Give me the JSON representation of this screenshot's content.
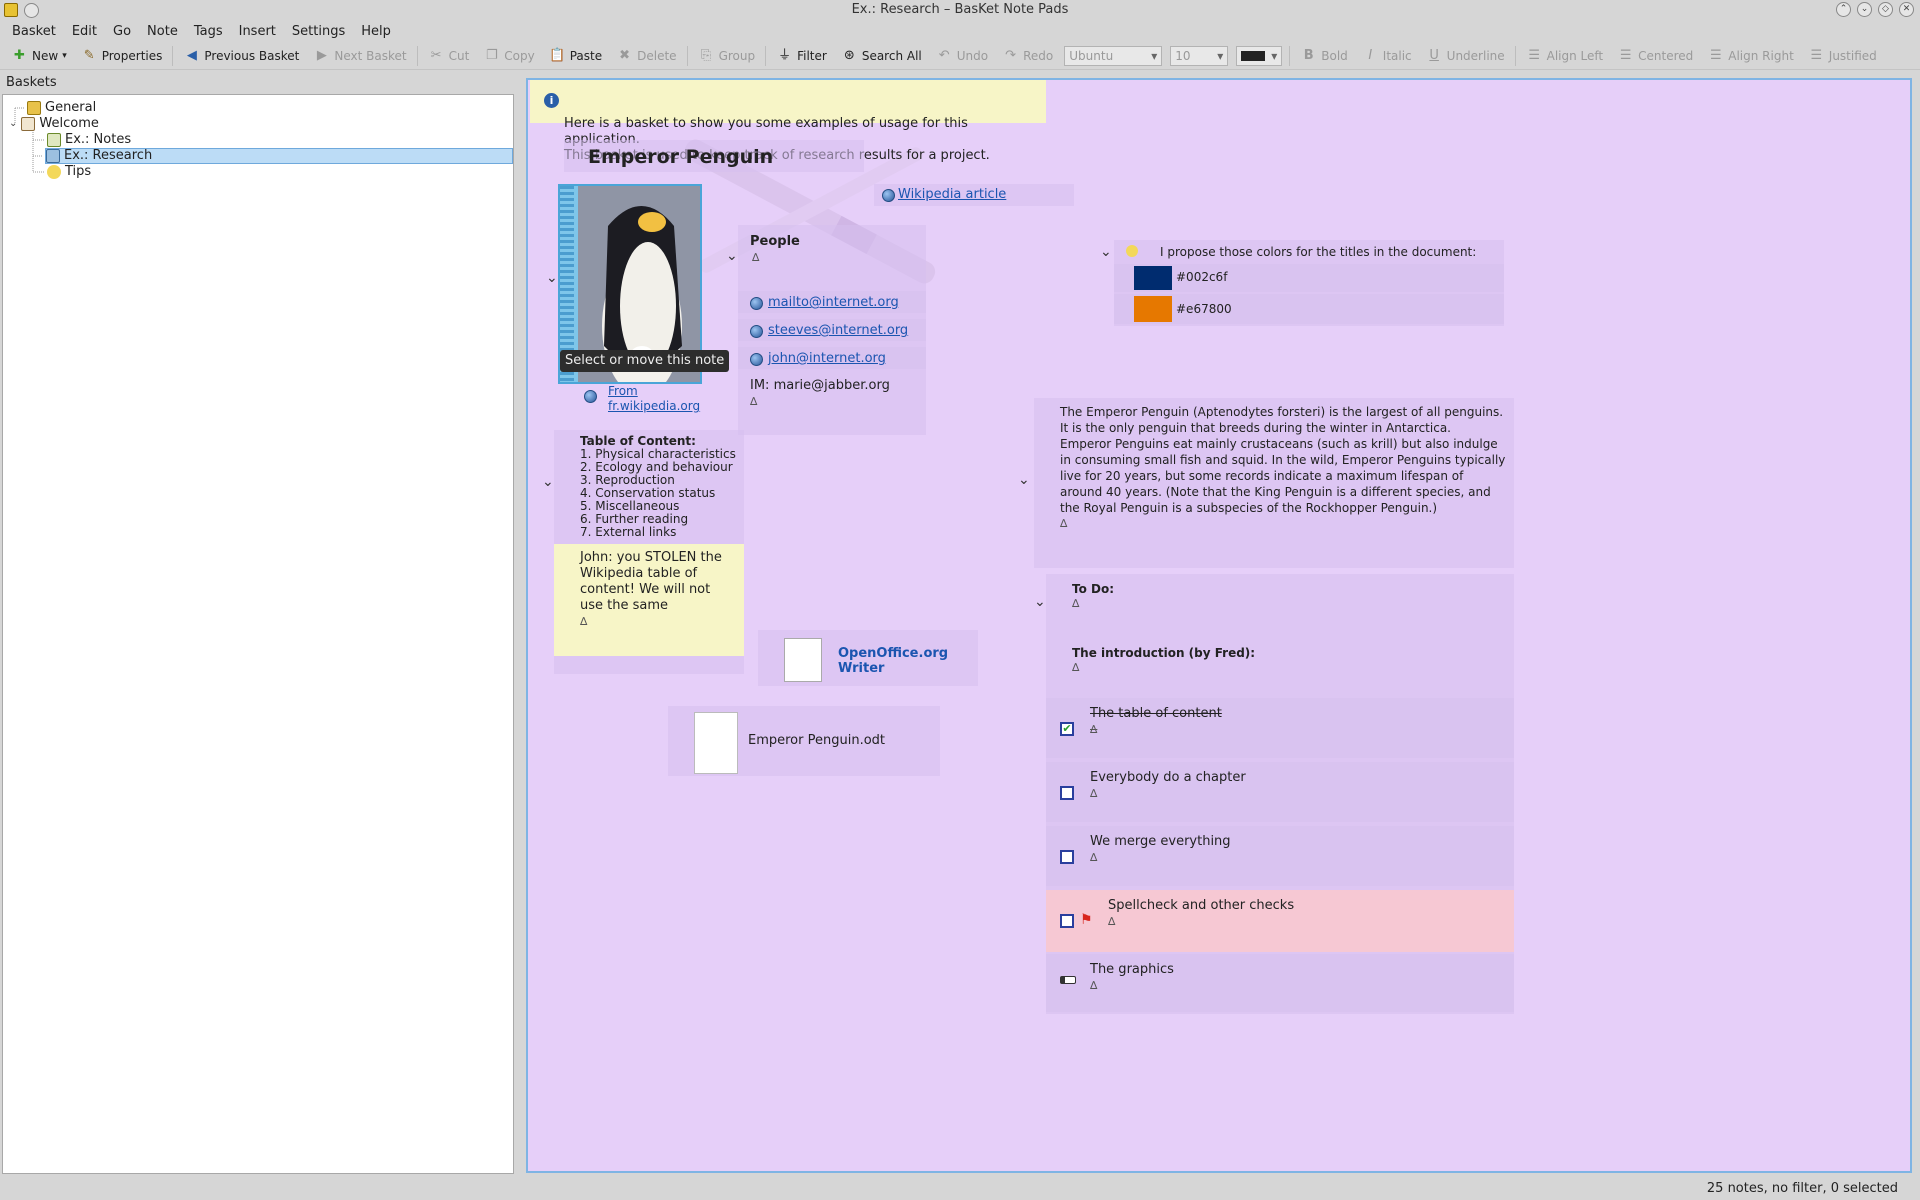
{
  "window": {
    "title": "Ex.: Research – BasKet Note Pads"
  },
  "menu": [
    "Basket",
    "Edit",
    "Go",
    "Note",
    "Tags",
    "Insert",
    "Settings",
    "Help"
  ],
  "toolbar": {
    "new": "New",
    "properties": "Properties",
    "previous_basket": "Previous Basket",
    "next_basket": "Next Basket",
    "cut": "Cut",
    "copy": "Copy",
    "paste": "Paste",
    "delete": "Delete",
    "group": "Group",
    "filter": "Filter",
    "search_all": "Search All",
    "undo": "Undo",
    "redo": "Redo",
    "font": "Ubuntu",
    "font_size": "10",
    "bold": "Bold",
    "italic": "Italic",
    "underline": "Underline",
    "align_left": "Align Left",
    "centered": "Centered",
    "align_right": "Align Right",
    "justified": "Justified"
  },
  "sidebar": {
    "header": "Baskets",
    "items": [
      {
        "label": "General"
      },
      {
        "label": "Welcome"
      },
      {
        "label": "Ex.: Notes"
      },
      {
        "label": "Ex.: Research"
      },
      {
        "label": "Tips"
      }
    ]
  },
  "basket": {
    "intro": "Here is a basket to show you some examples of usage for this application.\nThis basket is used to keep track of research results for a project.",
    "title": "Emperor Penguin",
    "wikipedia_link": "Wikipedia article",
    "tooltip": "Select or move this note",
    "image_source": "From fr.wikipedia.org",
    "people": {
      "heading": "People",
      "marker": "∆",
      "emails": [
        "mailto@internet.org",
        "steeves@internet.org",
        "john@internet.org"
      ],
      "im": "IM: marie@jabber.org",
      "im_marker": "∆"
    },
    "colors": {
      "label": "I propose those colors for the titles in the document:",
      "items": [
        {
          "hex": "#002c6f",
          "label": "#002c6f"
        },
        {
          "hex": "#e67800",
          "label": "#e67800"
        }
      ]
    },
    "toc": {
      "heading": "Table of Content:",
      "items": [
        "1. Physical characteristics",
        "2. Ecology and behaviour",
        "3. Reproduction",
        "4. Conservation status",
        "5. Miscellaneous",
        "6. Further reading",
        "7. External links"
      ]
    },
    "sticky": {
      "text": "John: you STOLEN the Wikipedia table of content! We will not use the same",
      "marker": "∆"
    },
    "openoffice": "OpenOffice.org Writer",
    "odt_file": "Emperor Penguin.odt",
    "description": "The Emperor Penguin (Aptenodytes forsteri) is the largest of all penguins. It is the only penguin that breeds during the winter in Antarctica. Emperor Penguins eat mainly crustaceans (such as krill) but also indulge in consuming small fish and squid. In the wild, Emperor Penguins typically live for 20 years, but some records indicate a maximum lifespan of around 40 years. (Note that the King Penguin is a different species, and the Royal Penguin is a subspecies of the Rockhopper Penguin.)",
    "description_marker": "∆",
    "todo": {
      "heading": "To Do:",
      "marker": "∆",
      "intro_heading": "The introduction (by Fred):",
      "intro_marker": "∆",
      "tasks": [
        {
          "label": "The table of content",
          "marker": "∆",
          "checked": true
        },
        {
          "label": "Everybody do a chapter",
          "marker": "∆",
          "checked": false
        },
        {
          "label": "We merge everything",
          "marker": "∆",
          "checked": false
        },
        {
          "label": "Spellcheck and other checks",
          "marker": "∆",
          "checked": false
        },
        {
          "label": "The graphics",
          "marker": "∆"
        }
      ]
    }
  },
  "status": "25 notes, no filter, 0 selected",
  "colors_ui": {
    "basket_bg": "#e6cff9",
    "selection": "#bcdcf6",
    "sticky": "#f7f5c7",
    "highlight": "#f6c8d3"
  }
}
